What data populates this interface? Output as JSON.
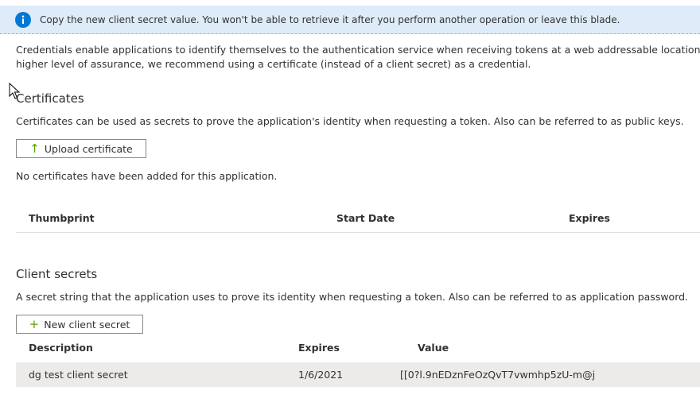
{
  "banner": {
    "message": "Copy the new client secret value. You won't be able to retrieve it after you perform another operation or leave this blade."
  },
  "intro": {
    "line1": "Credentials enable applications to identify themselves to the authentication service when receiving tokens at a web addressable location (using an HTT",
    "line2": "higher level of assurance, we recommend using a certificate (instead of a client secret) as a credential."
  },
  "certificates": {
    "title": "Certificates",
    "description": "Certificates can be used as secrets to prove the application's identity when requesting a token. Also can be referred to as public keys.",
    "upload_label": "Upload certificate",
    "empty_message": "No certificates have been added for this application.",
    "columns": [
      "Thumbprint",
      "Start Date",
      "Expires"
    ]
  },
  "client_secrets": {
    "title": "Client secrets",
    "description": "A secret string that the application uses to prove its identity when requesting a token. Also can be referred to as application password.",
    "new_label": "New client secret",
    "columns": [
      "Description",
      "Expires",
      "Value"
    ],
    "rows": [
      {
        "description": "dg test client secret",
        "expires": "1/6/2021",
        "value": "[[0?l.9nEDznFeOzQvT7vwmhp5zU-m@j"
      }
    ]
  },
  "colors": {
    "banner_bg": "#deecf9",
    "info_icon": "#0078d4",
    "accent_green": "#57a300",
    "row_highlight": "#edebe9"
  },
  "icons": {
    "banner": "info-icon",
    "upload": "upload-arrow-icon",
    "add": "plus-icon",
    "cursor": "mouse-pointer-icon"
  }
}
